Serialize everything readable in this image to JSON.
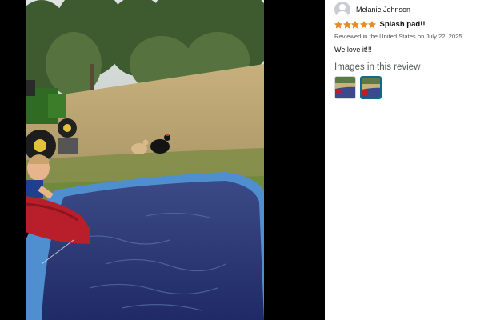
{
  "review": {
    "reviewer_name": "Melanie Johnson",
    "rating": 5,
    "rating_max": 5,
    "title": "Splash pad!!",
    "meta": "Reviewed in the United States on July 22, 2025",
    "body": "We love it!!!"
  },
  "images_section": {
    "heading": "Images in this review",
    "thumbnail_count": 2,
    "selected_index": 1
  },
  "colors": {
    "star": "#f08a1c",
    "selected_border": "#0f6b8a",
    "viewer_background": "#000000"
  },
  "icons": {
    "avatar": "user-avatar-icon",
    "star": "star-icon"
  }
}
